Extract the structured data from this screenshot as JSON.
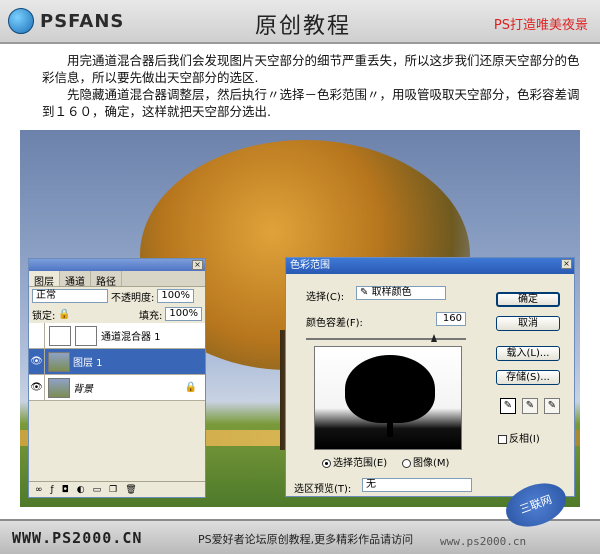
{
  "header": {
    "logo_text": "PSFANS",
    "title": "原创教程",
    "slogan": "PS打造唯美夜景"
  },
  "intro": {
    "paragraphs": [
      "用完通道混合器后我们会发现图片天空部分的细节严重丢失，所以这步我们还原天空部分的色彩信息，所以要先做出天空部分的选区.",
      "先隐藏通道混合器调整层，然后执行〃选择－色彩范围〃，用吸管吸取天空部分，色彩容差调到１６０，确定，这样就把天空部分选出."
    ]
  },
  "layers_panel": {
    "tabs": [
      "图层",
      "通道",
      "路径"
    ],
    "blend_mode": "正常",
    "opacity_label": "不透明度:",
    "opacity_value": "100%",
    "lock_label": "锁定:",
    "fill_label": "填充:",
    "fill_value": "100%",
    "layers": [
      {
        "name": "通道混合器 1",
        "visible": false
      },
      {
        "name": "图层 1",
        "visible": true,
        "selected": true
      },
      {
        "name": "背景",
        "visible": true
      }
    ]
  },
  "color_range_dialog": {
    "title": "色彩范围",
    "select_label": "选择(C):",
    "select_value": "取样颜色",
    "fuzziness_label": "颜色容差(F):",
    "fuzziness_value": "160",
    "fuzziness_fraction": 0.8,
    "radio_selection": "选择范围(E)",
    "radio_image": "图像(M)",
    "preview_label": "选区预览(T):",
    "preview_value": "无",
    "buttons": {
      "ok": "确定",
      "cancel": "取消",
      "load": "载入(L)...",
      "save": "存储(S)..."
    },
    "invert_label": "反相(I)"
  },
  "footer": {
    "url": "WWW.PS2000.CN",
    "text": "PS爱好者论坛原创教程,更多精彩作品请访问",
    "url2": "www.ps2000.cn"
  },
  "watermark": {
    "text": "三联网"
  }
}
